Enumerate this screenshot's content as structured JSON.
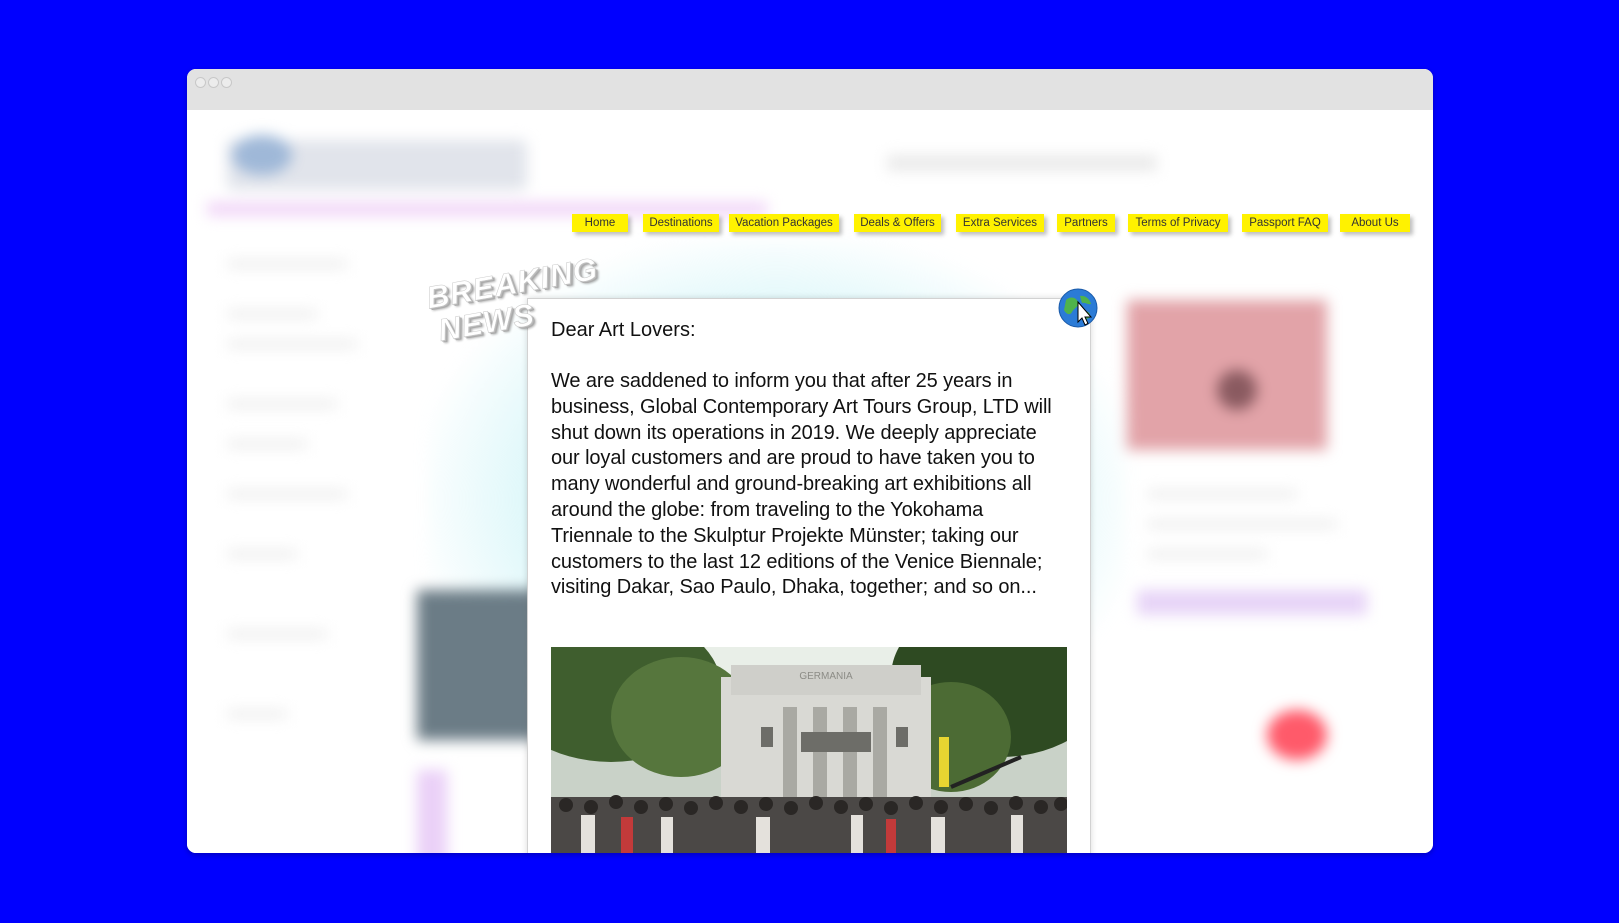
{
  "window": {
    "traffic_lights": [
      "close",
      "minimize",
      "maximize"
    ]
  },
  "nav": {
    "items": [
      {
        "label": "Home"
      },
      {
        "label": "Destinations"
      },
      {
        "label": "Vacation Packages"
      },
      {
        "label": "Deals & Offers"
      },
      {
        "label": "Extra Services"
      },
      {
        "label": "Partners"
      },
      {
        "label": "Terms of Privacy"
      },
      {
        "label": "Passport FAQ"
      },
      {
        "label": "About Us"
      }
    ],
    "color": "#fff200"
  },
  "badge": {
    "line1": "BREAKING",
    "line2": "NEWS"
  },
  "modal": {
    "greeting": "Dear Art Lovers:",
    "message": "We are saddened to inform you that after 25 years in business, Global Contemporary Art Tours Group, LTD will shut down its operations in 2019. We deeply appreciate our loyal customers and are proud to have taken you to many wonderful and ground-breaking art exhibitions all around the globe: from traveling to the Yokohama Triennale to the Skulptur Projekte Münster; taking our customers to the last 12 editions of the Venice Biennale; visiting Dakar, Sao Paulo, Dhaka, together; and so on...",
    "photo_sign": "GERMANIA",
    "icon": "globe-cursor-icon"
  },
  "colors": {
    "background": "#0000ff",
    "accent": "#fff200"
  }
}
